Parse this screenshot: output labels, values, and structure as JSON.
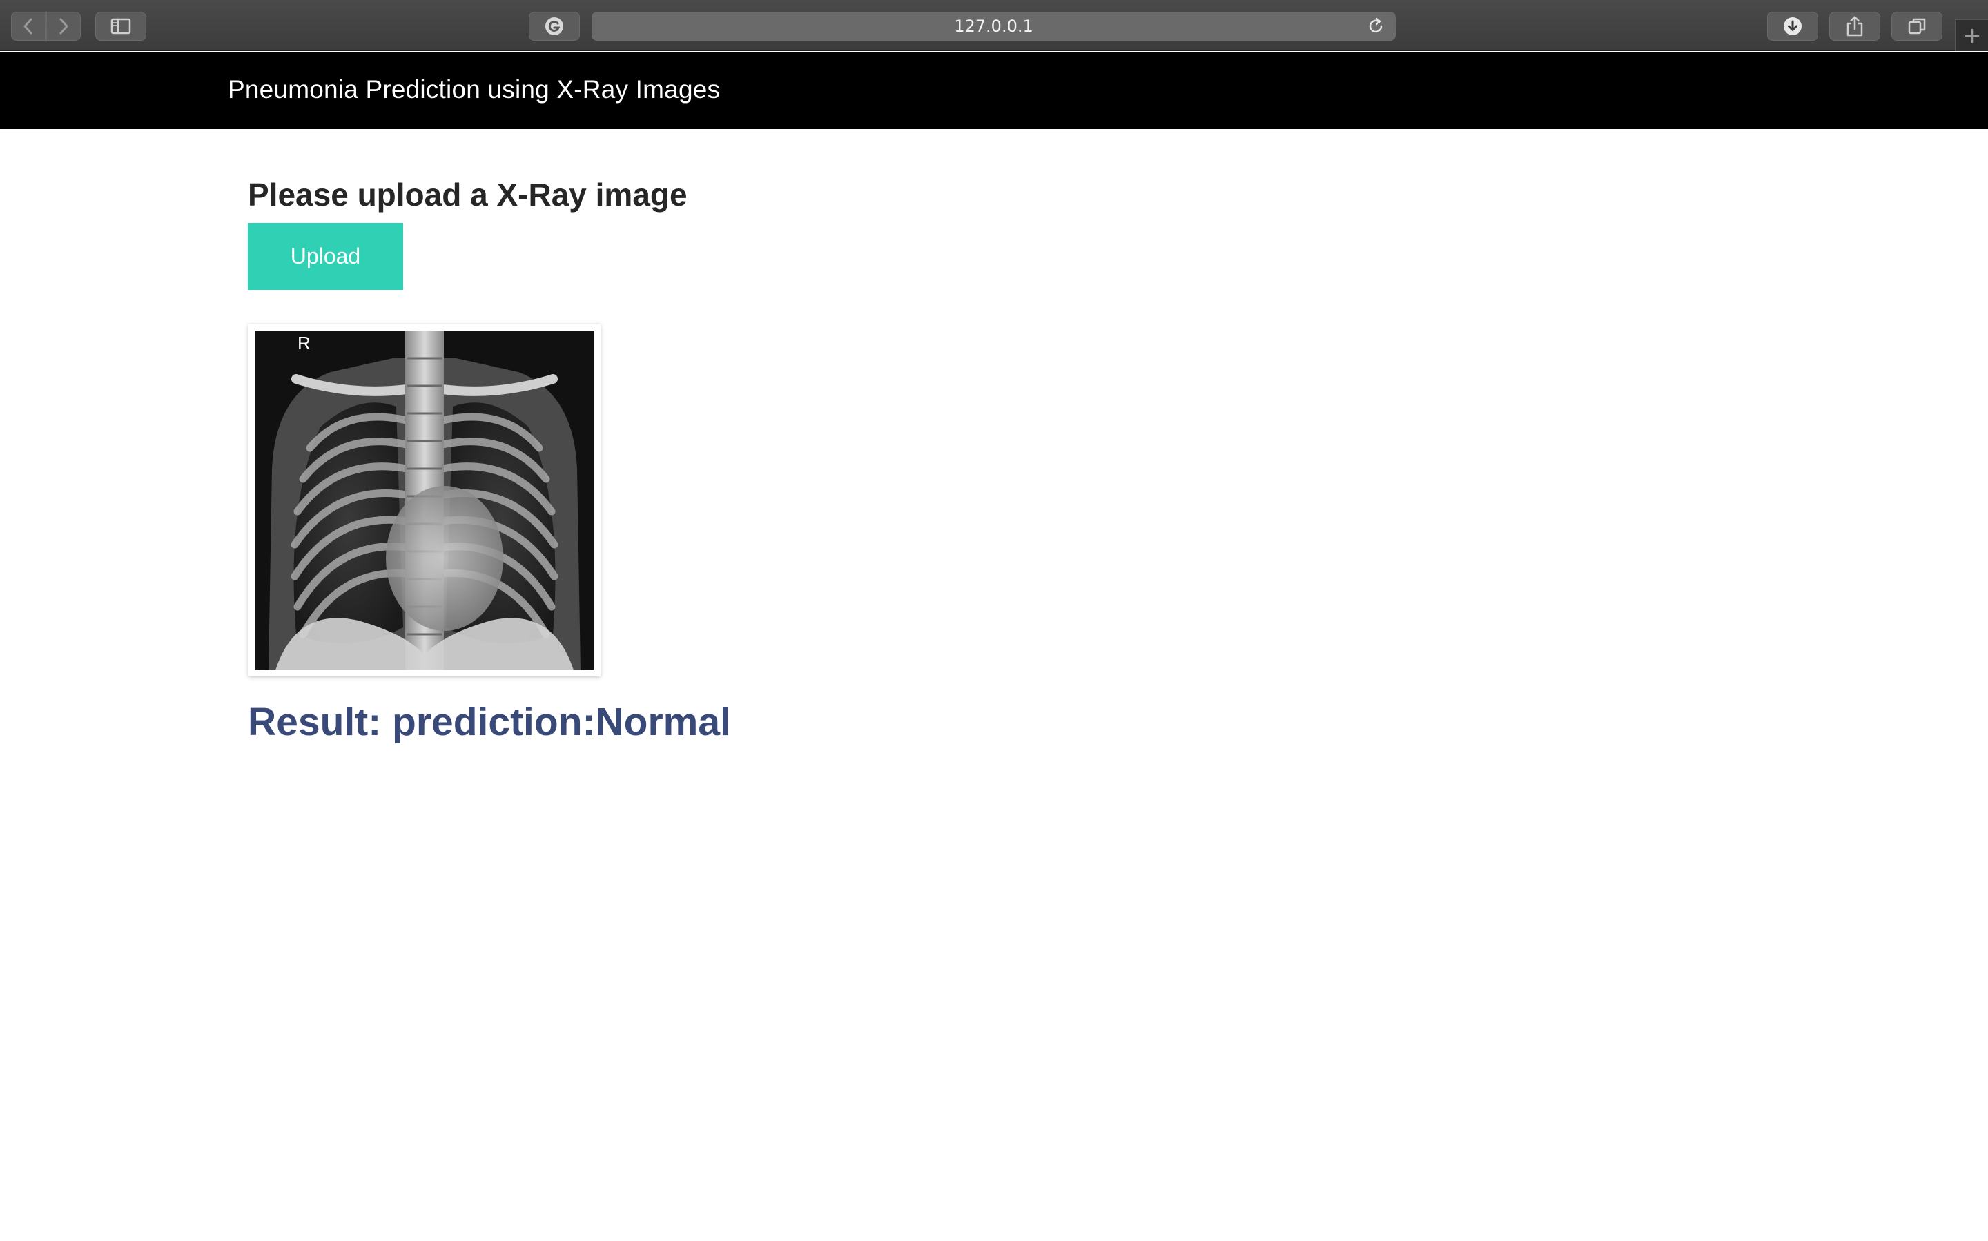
{
  "browser": {
    "url": "127.0.0.1",
    "icons": {
      "back": "chevron-left-icon",
      "forward": "chevron-right-icon",
      "sidebar": "sidebar-icon",
      "extension": "grammarly-icon",
      "reload": "reload-icon",
      "download": "download-icon",
      "share": "share-icon",
      "tabs": "tab-overview-icon",
      "new_tab": "plus-icon"
    }
  },
  "navbar": {
    "brand": "Pneumonia Prediction using X-Ray Images",
    "background": "#000000"
  },
  "main": {
    "heading": "Please upload a X-Ray image",
    "upload_label": "Upload",
    "upload_color": "#2fd0b4",
    "preview_marker": "R",
    "result_text": "Result: prediction:Normal",
    "result_color": "#3a4a78"
  }
}
